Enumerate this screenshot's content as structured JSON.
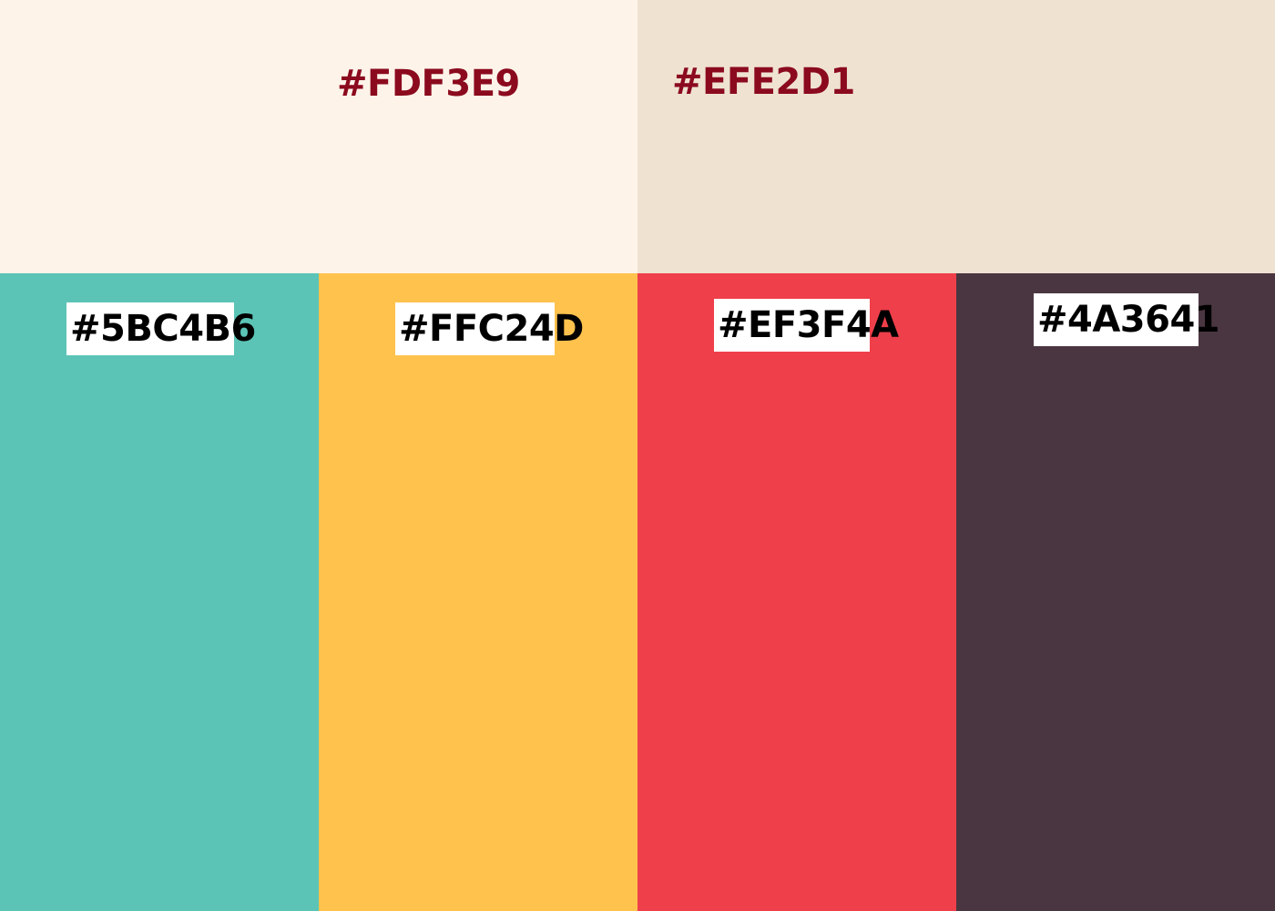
{
  "swatches_top": [
    {
      "hex": "#FDF3E9",
      "label": "#FDF3E9",
      "text_color": "#8B0A1E"
    },
    {
      "hex": "#EFE2D1",
      "label": "#EFE2D1",
      "text_color": "#8B0A1E"
    }
  ],
  "swatches_bottom": [
    {
      "hex": "#5BC4B6",
      "label": "#5BC4B6"
    },
    {
      "hex": "#FFC24D",
      "label": "#FFC24D"
    },
    {
      "hex": "#EF3F4A",
      "label": "#EF3F4A"
    },
    {
      "hex": "#4A3641",
      "label": "#4A3641"
    }
  ]
}
